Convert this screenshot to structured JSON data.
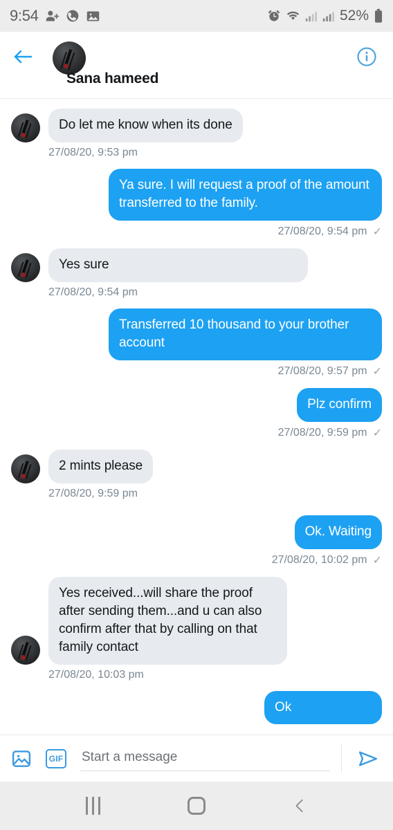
{
  "status_bar": {
    "time": "9:54",
    "battery": "52%",
    "left_icons": [
      "add-contact-icon",
      "phone-clock-icon",
      "image-icon"
    ],
    "right_icons": [
      "alarm-icon",
      "wifi-icon",
      "signal-icon",
      "signal-icon",
      "battery-icon"
    ]
  },
  "header": {
    "back_label": "Back",
    "contact_name": "Sana hameed",
    "info_label": "Conversation info"
  },
  "messages": [
    {
      "direction": "in",
      "text": "Do let me know when its done",
      "timestamp": "27/08/20, 9:53 pm",
      "tick": ""
    },
    {
      "direction": "out",
      "text": "Ya sure. I will request a proof of the amount transferred to the family.",
      "timestamp": "27/08/20, 9:54 pm",
      "tick": "✓"
    },
    {
      "direction": "in",
      "text": "Yes sure",
      "timestamp": "27/08/20, 9:54 pm",
      "tick": ""
    },
    {
      "direction": "out",
      "text": "Transferred 10 thousand to your brother account",
      "timestamp": "27/08/20, 9:57 pm",
      "tick": "✓"
    },
    {
      "direction": "out",
      "text": "Plz confirm",
      "timestamp": "27/08/20, 9:59 pm",
      "tick": "✓"
    },
    {
      "direction": "in",
      "text": "2 mints please",
      "timestamp": "27/08/20, 9:59 pm",
      "tick": ""
    },
    {
      "direction": "out",
      "text": "Ok. Waiting",
      "timestamp": "27/08/20, 10:02 pm",
      "tick": "✓"
    },
    {
      "direction": "in",
      "text": "Yes received...will share the proof after sending them...and u can also confirm after that by calling on that family contact",
      "timestamp": "27/08/20, 10:03 pm",
      "tick": ""
    }
  ],
  "partial_message": {
    "direction": "out",
    "text": "Ok"
  },
  "composer": {
    "photo_label": "Add photo",
    "gif_label": "GIF",
    "placeholder": "Start a message",
    "value": "",
    "send_label": "Send"
  },
  "nav_bar": {
    "recents_label": "Recents",
    "home_label": "Home",
    "back_label": "Back"
  },
  "colors": {
    "accent": "#1da1f2",
    "incoming_bubble": "#e7eaee",
    "outgoing_bubble": "#1da1f2",
    "status_bar": "#ededed",
    "timestamp_text": "#7a8792"
  }
}
